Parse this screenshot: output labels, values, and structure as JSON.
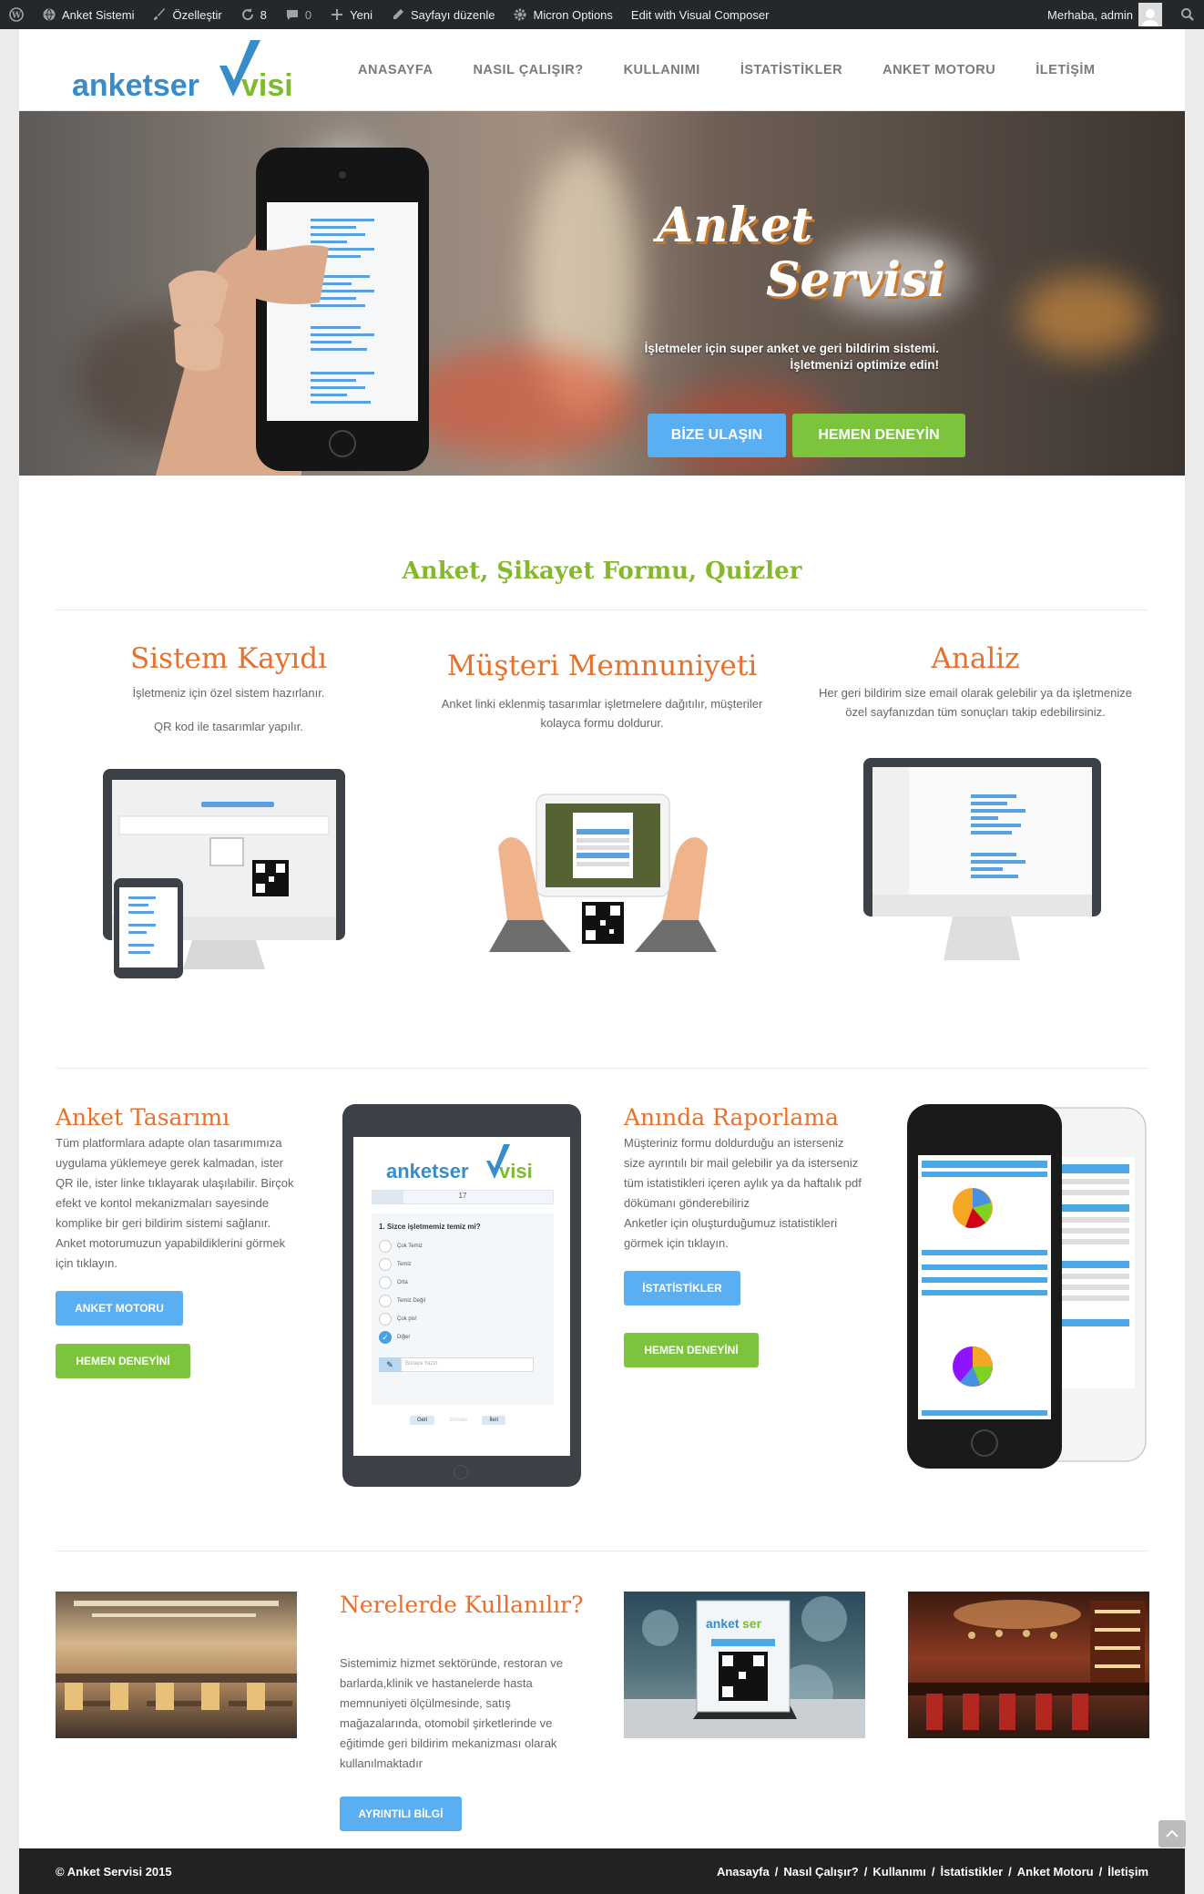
{
  "adminbar": {
    "site_name": "Anket Sistemi",
    "customize": "Özelleştir",
    "updates": "8",
    "comments": "0",
    "new": "Yeni",
    "edit_page": "Sayfayı düzenle",
    "micron": "Micron Options",
    "visual_composer": "Edit with Visual Composer",
    "greeting": "Merhaba, admin"
  },
  "logo": {
    "part1": "anketser",
    "part2": "visi"
  },
  "nav": [
    "ANASAYFA",
    "NASIL ÇALIŞIR?",
    "KULLANIMI",
    "İSTATİSTİKLER",
    "ANKET MOTORU",
    "İLETİŞİM"
  ],
  "hero": {
    "title_line1": "Anket",
    "title_line2": "Servisi",
    "subtitle_line1": "İşletmeler için super anket ve geri bildirim sistemi.",
    "subtitle_line2": "İşletmenizi optimize edin!",
    "btn_contact": "BİZE ULAŞIN",
    "btn_try": "HEMEN DENEYİN"
  },
  "section1": {
    "title": "Anket, Şikayet Formu, Quizler",
    "features": [
      {
        "title": "Sistem Kayıdı",
        "text1": "İşletmeniz için özel sistem hazırlanır.",
        "text2": "QR kod ile tasarımlar yapılır."
      },
      {
        "title": "Müşteri Memnuniyeti",
        "text1": "Anket linki eklenmiş tasarımlar işletmelere dağıtılır, müşteriler",
        "text2": "kolayca formu doldurur."
      },
      {
        "title": "Analiz",
        "text1": "Her geri bildirim size email olarak gelebilir ya da işletmenize",
        "text2": "özel sayfanızdan tüm sonuçları takip edebilirsiniz."
      }
    ]
  },
  "section2": {
    "design": {
      "title": "Anket Tasarımı",
      "lines": [
        "Tüm platformlara adapte olan tasarımımıza",
        "uygulama yüklemeye gerek kalmadan, ister",
        "QR ile, ister linke tıklayarak ulaşılabilir. Birçok",
        "efekt ve kontol mekanizmaları sayesinde",
        "komplike bir geri bildirim sistemi sağlanır.",
        "Anket motorumuzun yapabildiklerini görmek",
        "için tıklayın."
      ],
      "btn1": "ANKET MOTORU",
      "btn2": "HEMEN DENEYİNİ"
    },
    "reporting": {
      "title": "Anında Raporlama",
      "lines": [
        "Müşteriniz formu doldurduğu an isterseniz",
        "size ayrıntılı bir mail gelebilir ya da isterseniz",
        "tüm istatistikleri içeren aylık ya da haftalık pdf",
        "dökümanı gönderebiliriz",
        "Anketler için oluşturduğumuz istatistikleri",
        "görmek için tıklayın."
      ],
      "btn1": "İSTATİSTİKLER",
      "btn2": "HEMEN DENEYİNİ"
    },
    "tablet": {
      "progress": "17",
      "question": "1. Sizce işletmemiz temiz mi?",
      "options": [
        "Çok Temiz",
        "Temiz",
        "Orta",
        "Temiz Değil",
        "Çok pis!",
        "Diğer"
      ],
      "other_placeholder": "Buraya Yazın",
      "btn_back": "Geri",
      "btn_mid": "Gönder",
      "btn_next": "İleri"
    }
  },
  "section3": {
    "title": "Nerelerde Kullanılır?",
    "lines": [
      "Sistemimiz hizmet sektöründe, restoran ve",
      "barlarda,klinik ve hastanelerde hasta",
      "memnuniyeti ölçülmesinde, satış",
      "mağazalarında, otomobil şirketlerinde ve",
      "eğitimde geri bildirim mekanizması olarak",
      "kullanılmaktadır"
    ],
    "btn": "AYRINTILI BİLGİ"
  },
  "footer": {
    "copyright": "© Anket Servisi 2015",
    "links": [
      "Anasayfa",
      "Nasıl Çalışır?",
      "Kullanımı",
      "İstatistikler",
      "Anket Motoru",
      "İletişim"
    ],
    "separator": "/"
  },
  "colors": {
    "accent_orange": "#e8702a",
    "accent_green": "#86b82c",
    "btn_blue": "#5aaff3",
    "btn_green": "#7dc43d"
  }
}
